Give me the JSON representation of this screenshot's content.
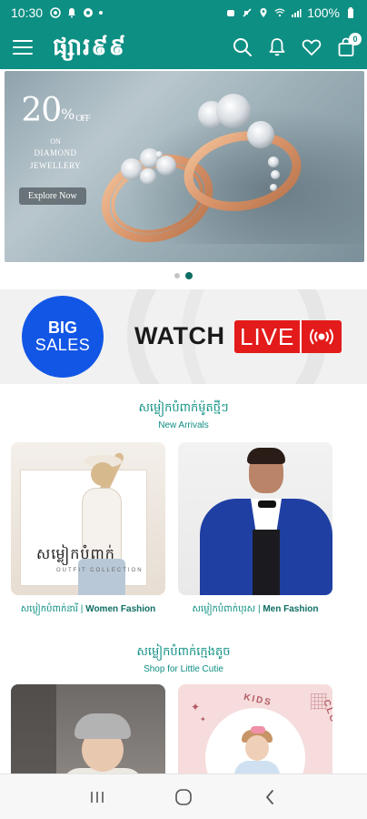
{
  "status_bar": {
    "time": "10:30",
    "battery": "100%"
  },
  "app_bar": {
    "brand": "ផ្សារ៩៩",
    "cart_count": "0",
    "accent_color": "#0e8f83"
  },
  "hero_banner": {
    "discount_value": "20",
    "discount_percent_sign": "%",
    "off_text": "OFF",
    "on_text": "ON",
    "line1": "DIAMOND",
    "line2": "JEWELLERY",
    "cta_label": "Explore Now",
    "active_slide": 2,
    "slide_count": 2
  },
  "sales_banner": {
    "badge_line1": "BIG",
    "badge_line2": "SALES",
    "watch_text": "WATCH",
    "live_text": "LIVE"
  },
  "new_arrivals": {
    "title_km": "សម្លៀកបំពាក់ម៉ូតថ្មីៗ",
    "title_en": "New Arrivals",
    "cards": [
      {
        "image_title": "សម្លៀកបំពាក់",
        "image_subtitle": "OUTFIT COLLECTION",
        "label_km": "សម្លៀកបំពាក់នារី",
        "label_sep": " | ",
        "label_en": "Women Fashion"
      },
      {
        "label_km": "សម្លៀកបំពាក់បុរស",
        "label_sep": " | ",
        "label_en": "Men Fashion"
      }
    ]
  },
  "kids_section": {
    "title_km": "សម្លៀកបំពាក់ក្មេងតូច",
    "title_en": "Shop for Little Cutie",
    "cards": [
      {},
      {
        "image_title_1": "KIDS",
        "image_title_2": "CLOTHING"
      }
    ]
  },
  "icons": {
    "menu": "hamburger-icon",
    "search": "search-icon",
    "notifications": "bell-icon",
    "wishlist": "heart-icon",
    "cart": "shopping-bag-icon",
    "live": "broadcast-icon",
    "nav_recent": "recent-apps-icon",
    "nav_home": "home-icon",
    "nav_back": "back-icon"
  }
}
